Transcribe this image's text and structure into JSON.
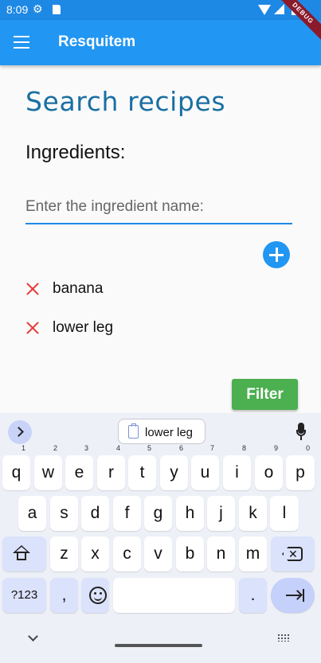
{
  "status_bar": {
    "time": "8:09",
    "icons": [
      "gear-icon",
      "sd-card-icon",
      "wifi-icon",
      "signal-icon",
      "battery-icon"
    ],
    "debug_banner": "DEBUG"
  },
  "app_bar": {
    "title": "Resquitem",
    "menu_icon": "menu-icon",
    "color": "#2196f3"
  },
  "main": {
    "page_title": "Search recipes",
    "section_label": "Ingredients:",
    "ingredient_input": {
      "placeholder": "Enter the ingredient name:",
      "value": ""
    },
    "add_button_icon": "plus-icon",
    "ingredients": [
      {
        "label": "banana",
        "remove_icon": "close-icon"
      },
      {
        "label": "lower leg",
        "remove_icon": "close-icon"
      }
    ],
    "filter_button": "Filter",
    "filter_color": "#4caf50"
  },
  "keyboard": {
    "suggestion": "lower leg",
    "row1": [
      {
        "key": "q",
        "hint": "1"
      },
      {
        "key": "w",
        "hint": "2"
      },
      {
        "key": "e",
        "hint": "3"
      },
      {
        "key": "r",
        "hint": "4"
      },
      {
        "key": "t",
        "hint": "5"
      },
      {
        "key": "y",
        "hint": "6"
      },
      {
        "key": "u",
        "hint": "7"
      },
      {
        "key": "i",
        "hint": "8"
      },
      {
        "key": "o",
        "hint": "9"
      },
      {
        "key": "p",
        "hint": "0"
      }
    ],
    "row2": [
      "a",
      "s",
      "d",
      "f",
      "g",
      "h",
      "j",
      "k",
      "l"
    ],
    "row3": [
      "z",
      "x",
      "c",
      "v",
      "b",
      "n",
      "m"
    ],
    "symbols_key": "?123",
    "comma_key": ",",
    "period_key": "."
  }
}
